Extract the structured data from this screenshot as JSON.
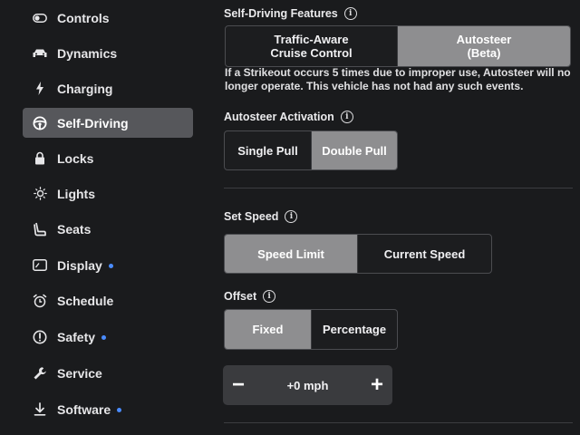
{
  "sidebar": {
    "items": [
      {
        "label": "Controls",
        "icon": "toggle-icon"
      },
      {
        "label": "Dynamics",
        "icon": "car-icon"
      },
      {
        "label": "Charging",
        "icon": "bolt-icon"
      },
      {
        "label": "Self-Driving",
        "icon": "steering-wheel-icon",
        "active": true
      },
      {
        "label": "Locks",
        "icon": "lock-icon"
      },
      {
        "label": "Lights",
        "icon": "light-icon"
      },
      {
        "label": "Seats",
        "icon": "seat-icon"
      },
      {
        "label": "Display",
        "icon": "display-icon",
        "dot": true
      },
      {
        "label": "Schedule",
        "icon": "alarm-clock-icon"
      },
      {
        "label": "Safety",
        "icon": "alert-icon",
        "dot": true
      },
      {
        "label": "Service",
        "icon": "wrench-icon"
      },
      {
        "label": "Software",
        "icon": "download-icon",
        "dot": true
      }
    ],
    "dot_color": "#4a8cff"
  },
  "self_driving_features": {
    "title": "Self-Driving Features",
    "options": [
      {
        "line1": "Traffic-Aware",
        "line2": "Cruise Control",
        "selected": false
      },
      {
        "line1": "Autosteer",
        "line2": "(Beta)",
        "selected": true
      }
    ],
    "note": "If a Strikeout occurs 5 times due to improper use, Autosteer will no longer operate. This vehicle has not had any such events."
  },
  "autosteer_activation": {
    "title": "Autosteer Activation",
    "options": [
      {
        "label": "Single Pull",
        "selected": false
      },
      {
        "label": "Double Pull",
        "selected": true
      }
    ]
  },
  "set_speed": {
    "title": "Set Speed",
    "options": [
      {
        "label": "Speed Limit",
        "selected": true
      },
      {
        "label": "Current Speed",
        "selected": false
      }
    ]
  },
  "offset": {
    "title": "Offset",
    "options": [
      {
        "label": "Fixed",
        "selected": true
      },
      {
        "label": "Percentage",
        "selected": false
      }
    ],
    "stepper": {
      "minus": "−",
      "value": "+0 mph",
      "plus": "+"
    }
  },
  "info_glyph": "i",
  "colors": {
    "selected": "#8e8e90",
    "active_sidebar": "#56575b",
    "background": "#1a1b1d"
  }
}
